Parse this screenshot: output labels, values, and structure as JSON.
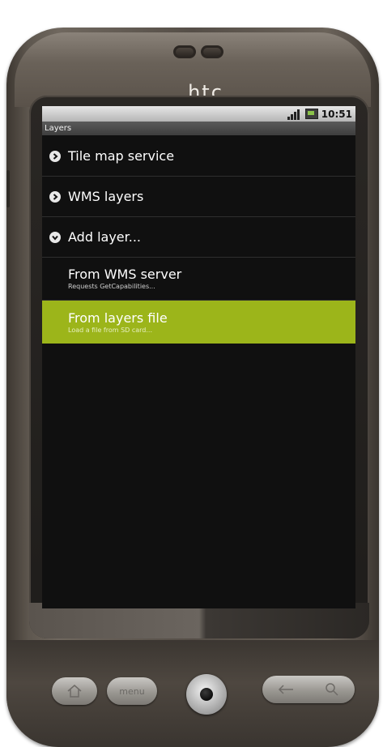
{
  "device": {
    "brand": "htc",
    "buttons": {
      "home_icon": "home-icon",
      "menu_label": "menu",
      "back_icon": "back-icon",
      "search_icon": "search-icon"
    }
  },
  "status_bar": {
    "time": "10:51",
    "signal_icon": "signal-icon",
    "battery_icon": "battery-icon"
  },
  "app": {
    "title": "Layers"
  },
  "list": {
    "items": [
      {
        "label": "Tile map service",
        "state": "collapsed"
      },
      {
        "label": "WMS layers",
        "state": "collapsed"
      },
      {
        "label": "Add layer...",
        "state": "expanded"
      }
    ],
    "sub_items": [
      {
        "label": "From WMS server",
        "desc": "Requests GetCapabilities..."
      },
      {
        "label": "From layers file",
        "desc": "Load a file from SD card..."
      }
    ]
  },
  "colors": {
    "selection": "#9cb51a",
    "screen_bg": "#101010"
  }
}
